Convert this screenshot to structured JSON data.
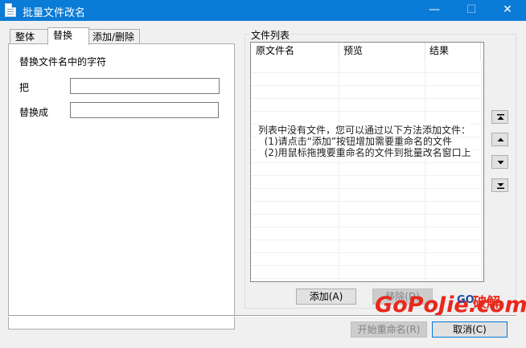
{
  "window": {
    "title": "批量文件改名",
    "minimize_glyph": "—",
    "maximize_glyph": "☐",
    "close_glyph": "✕"
  },
  "tabs": [
    {
      "label": "整体",
      "active": false
    },
    {
      "label": "替换",
      "active": true
    },
    {
      "label": "添加/删除",
      "active": false
    }
  ],
  "replace_panel": {
    "heading": "替换文件名中的字符",
    "find_label": "把",
    "find_value": "",
    "replace_label": "替换成",
    "replace_value": ""
  },
  "file_list": {
    "group_title": "文件列表",
    "columns": [
      "原文件名",
      "预览",
      "结果"
    ],
    "empty_hint": [
      "列表中没有文件，您可以通过以下方法添加文件：",
      "  (1)请点击“添加”按钮增加需要重命名的文件",
      "  (2)用鼠标拖拽要重命名的文件到批量改名窗口上"
    ],
    "add_button": "添加(A)",
    "remove_button": "移除(D)"
  },
  "order_buttons": [
    "move-top-icon",
    "move-up-icon",
    "move-down-icon",
    "move-bottom-icon"
  ],
  "footer": {
    "start_button": "开始重命名(R)",
    "cancel_button": "取消(C)"
  },
  "watermark": {
    "main": "GoPoJie.com",
    "small": "GO",
    "cn": "破解"
  }
}
